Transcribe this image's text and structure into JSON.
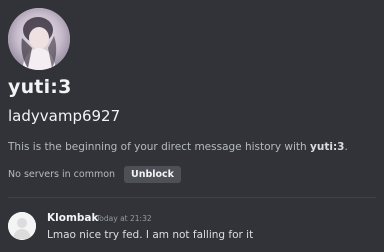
{
  "profile": {
    "display_name": "yuti:3",
    "username": "ladyvamp6927"
  },
  "intro": {
    "prefix": "This is the beginning of your direct message history with ",
    "name": "yuti:3",
    "suffix": "."
  },
  "mutual": {
    "text": "No servers in common",
    "unblock_label": "Unblock"
  },
  "message": {
    "author": "Klombak",
    "timestamp": "Today at 21:32",
    "content": "Lmao nice try fed. I am not falling for it"
  },
  "colors": {
    "background": "#313338",
    "button": "#4e5058",
    "muted_text": "#b5bac1"
  }
}
